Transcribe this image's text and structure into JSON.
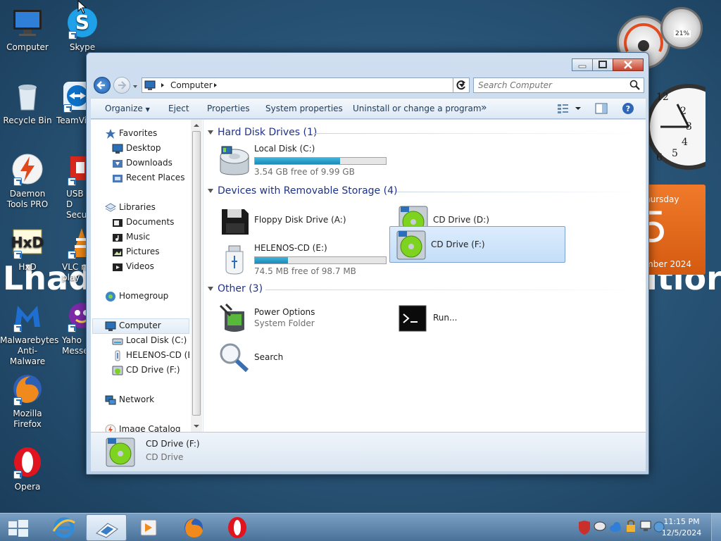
{
  "desktop": {
    "watermark_left": "Lhad",
    "watermark_right": "itior",
    "icons": [
      {
        "label": "Computer"
      },
      {
        "label": "Skype"
      },
      {
        "label": "Recycle Bin"
      },
      {
        "label": "TeamVi"
      },
      {
        "label": "Daemon Tools PRO"
      },
      {
        "label": "USB D Secu"
      },
      {
        "label": "HxD"
      },
      {
        "label": "VLC m play"
      },
      {
        "label": "Malwarebytes Anti-Malware"
      },
      {
        "label": "Yaho Messe"
      },
      {
        "label": "Mozilla Firefox"
      },
      {
        "label": "Opera"
      }
    ]
  },
  "gadgets": {
    "meter_percent": "21%",
    "calendar_day_name": "hursday",
    "calendar_day": "5",
    "calendar_month_year": "mber 2024",
    "clock_numbers": [
      "12",
      "2",
      "3",
      "4",
      "5",
      "6"
    ]
  },
  "explorer": {
    "address": "Computer",
    "search_placeholder": "Search Computer",
    "toolbar": {
      "organize": "Organize",
      "eject": "Eject",
      "properties": "Properties",
      "system_properties": "System properties",
      "uninstall": "Uninstall or change a program",
      "more": "»"
    },
    "nav": {
      "favorites": "Favorites",
      "desktop": "Desktop",
      "downloads": "Downloads",
      "recent_places": "Recent Places",
      "libraries": "Libraries",
      "documents": "Documents",
      "music": "Music",
      "pictures": "Pictures",
      "videos": "Videos",
      "homegroup": "Homegroup",
      "computer": "Computer",
      "local_disk": "Local Disk (C:)",
      "helenos": "HELENOS-CD (E:",
      "cd_drive_f": "CD Drive (F:)",
      "network": "Network",
      "image_catalog": "Image Catalog"
    },
    "groups": {
      "hard_disk": "Hard Disk Drives (1)",
      "removable": "Devices with Removable Storage (4)",
      "other": "Other (3)"
    },
    "items": {
      "local_disk": {
        "name": "Local Disk (C:)",
        "free": "3.54 GB free of 9.99 GB",
        "used_fraction": 0.65
      },
      "floppy": {
        "name": "Floppy Disk Drive (A:)"
      },
      "cd_d": {
        "name": "CD Drive (D:)"
      },
      "helenos": {
        "name": "HELENOS-CD (E:)",
        "free": "74.5 MB free of 98.7 MB",
        "used_fraction": 0.25
      },
      "cd_f": {
        "name": "CD Drive (F:)"
      },
      "power": {
        "name": "Power Options",
        "sub": "System Folder"
      },
      "run": {
        "name": "Run..."
      },
      "search": {
        "name": "Search"
      }
    },
    "details": {
      "name": "CD Drive (F:)",
      "type": "CD Drive"
    }
  },
  "taskbar": {
    "time": "11:15 PM",
    "date": "12/5/2024"
  },
  "colors": {
    "accent": "#1e3287",
    "selection": "#c4defa",
    "drive_bar": "#1a8ab8"
  }
}
